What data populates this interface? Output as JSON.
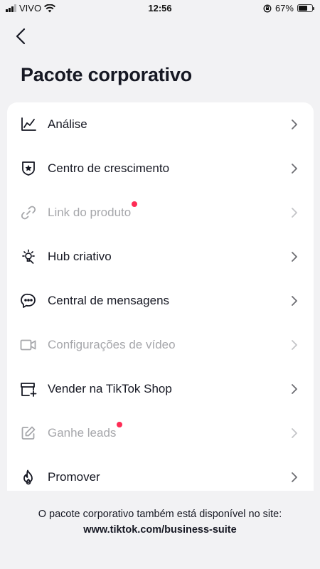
{
  "status_bar": {
    "carrier": "VIVO",
    "time": "12:56",
    "battery": "67%",
    "battery_level": 0.67
  },
  "header": {
    "back": "back-icon",
    "title": "Pacote corporativo"
  },
  "menu": [
    {
      "label": "Análise",
      "icon": "analytics-icon",
      "disabled": false,
      "dot": false
    },
    {
      "label": "Centro de crescimento",
      "icon": "shield-star-icon",
      "disabled": false,
      "dot": false
    },
    {
      "label": "Link do produto",
      "icon": "link-icon",
      "disabled": true,
      "dot": true
    },
    {
      "label": "Hub criativo",
      "icon": "lightbulb-icon",
      "disabled": false,
      "dot": false
    },
    {
      "label": "Central de mensagens",
      "icon": "chat-bubble-icon",
      "disabled": false,
      "dot": false
    },
    {
      "label": "Configurações de vídeo",
      "icon": "video-camera-icon",
      "disabled": true,
      "dot": false
    },
    {
      "label": "Vender na TikTok Shop",
      "icon": "shop-add-icon",
      "disabled": false,
      "dot": false
    },
    {
      "label": "Ganhe leads",
      "icon": "edit-form-icon",
      "disabled": true,
      "dot": true
    },
    {
      "label": "Promover",
      "icon": "flame-icon",
      "disabled": false,
      "dot": false
    }
  ],
  "footer": {
    "text": "O pacote corporativo também está disponível no site:",
    "link": "www.tiktok.com/business-suite"
  },
  "colors": {
    "background": "#f2f2f4",
    "text": "#161823",
    "disabled": "#a6a7ab",
    "dot": "#fe2c55"
  }
}
